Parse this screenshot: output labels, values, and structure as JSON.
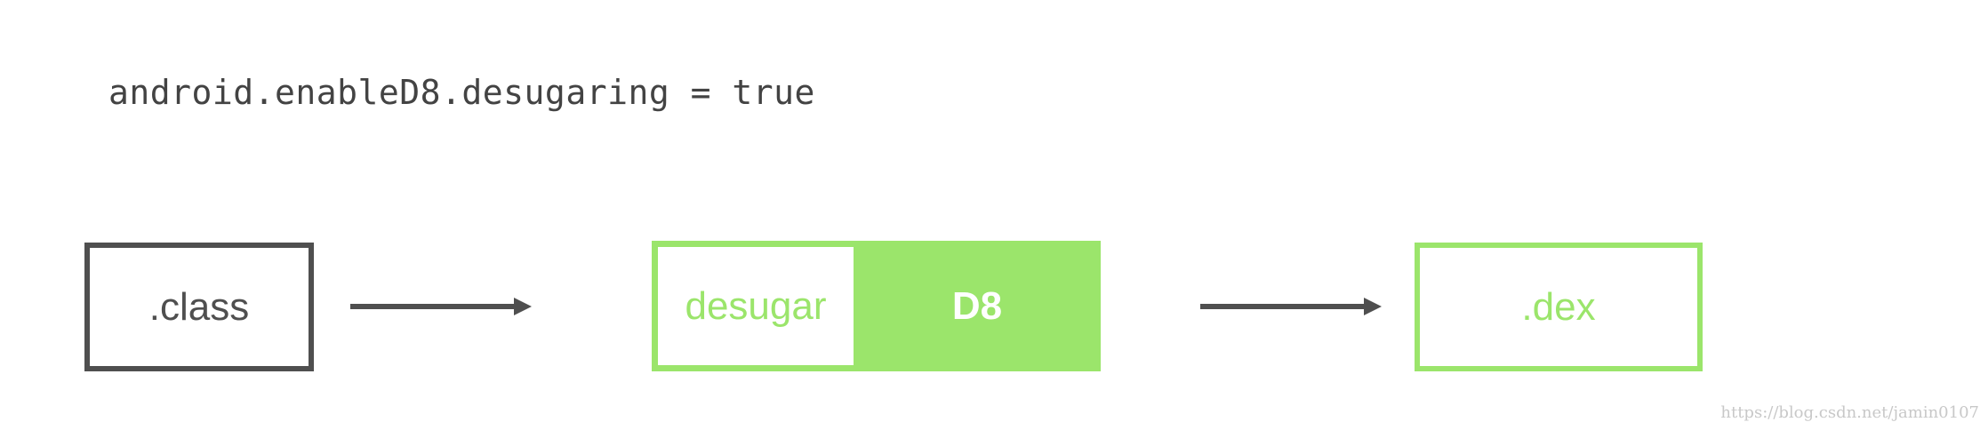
{
  "config": {
    "line": "android.enableD8.desugaring = true"
  },
  "diagram": {
    "input_box": {
      "label": ".class"
    },
    "processor_box": {
      "desugar_label": "desugar",
      "d8_label": "D8"
    },
    "output_box": {
      "label": ".dex"
    }
  },
  "colors": {
    "dark_gray": "#4f4f4f",
    "green": "#9be56b",
    "text_gray": "#434343"
  },
  "watermark": "https://blog.csdn.net/jamin0107"
}
